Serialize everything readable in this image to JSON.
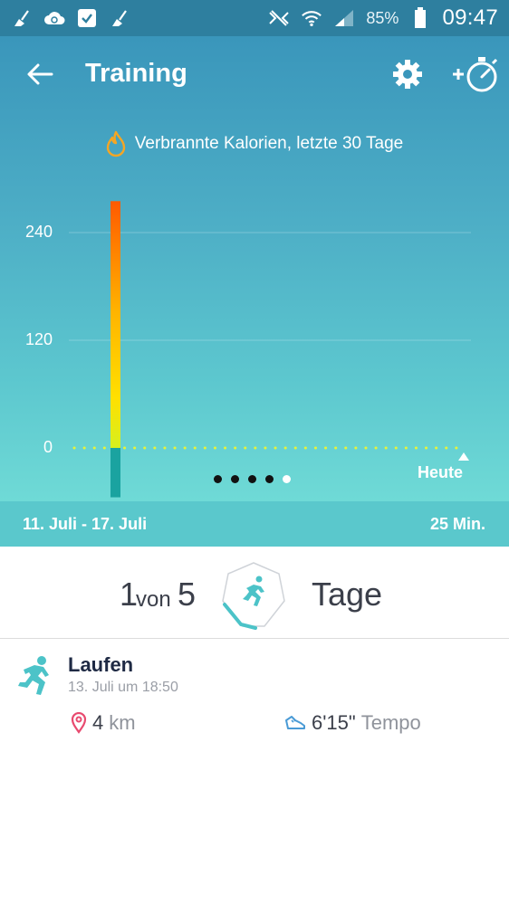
{
  "status_bar": {
    "battery_text": "85%",
    "time": "09:47"
  },
  "header": {
    "title": "Training"
  },
  "chart_title": "Verbrannte Kalorien, letzte 30 Tage",
  "chart_data": {
    "type": "bar",
    "y_ticks": [
      "240",
      "120",
      "0"
    ],
    "ylim": [
      -60,
      280
    ],
    "series": [
      {
        "values": [
          275
        ],
        "below_zero_value": -55
      }
    ],
    "today_label": "Heute",
    "gradient_colors": [
      "#ff6a00",
      "#ffd000",
      "#d4f020"
    ],
    "below_zero_color": "#1aa3a0"
  },
  "pager": {
    "count": 5,
    "active_index": 4
  },
  "summary": {
    "range": "11. Juli - 17. Juli",
    "duration": "25 Min."
  },
  "goal": {
    "count": "1",
    "von": "von",
    "total": "5",
    "unit": "Tage"
  },
  "activity": {
    "name": "Laufen",
    "date": "13. Juli um 18:50",
    "distance_value": "4",
    "distance_unit": "km",
    "pace_value": "6'15\"",
    "pace_unit": "Tempo"
  },
  "colors": {
    "accent": "#4cc3c8",
    "pin": "#e84a6f"
  }
}
